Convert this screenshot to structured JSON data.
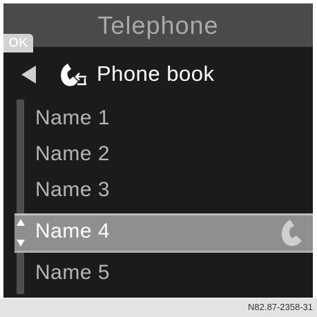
{
  "title": "Telephone",
  "ok_label": "OK",
  "header": {
    "label": "Phone book",
    "back_icon": "back-arrow-icon",
    "phonebook_icon": "phonebook-icon"
  },
  "list": {
    "items": [
      {
        "label": "Name 1"
      },
      {
        "label": "Name 2"
      },
      {
        "label": "Name 3"
      },
      {
        "label": "Name 4",
        "selected": true,
        "icon": "call-icon"
      },
      {
        "label": "Name 5"
      }
    ]
  },
  "footer": {
    "code": "N82.87-2358-31"
  },
  "colors": {
    "background": "#1c1b1b",
    "title_bar": "#4a4a4a",
    "selection": "#8f8f8f",
    "text_active": "#ffffff",
    "text_inactive": "#b6b6b6"
  }
}
